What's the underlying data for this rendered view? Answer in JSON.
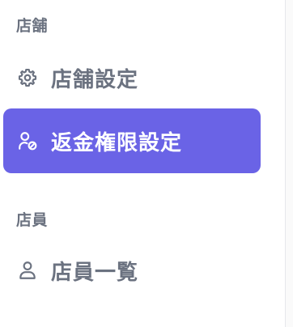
{
  "sidebar": {
    "sections": [
      {
        "title": "店舗",
        "items": [
          {
            "label": "店舗設定",
            "icon": "gear-icon",
            "active": false
          },
          {
            "label": "返金権限設定",
            "icon": "user-permission-icon",
            "active": true
          }
        ]
      },
      {
        "title": "店員",
        "items": [
          {
            "label": "店員一覧",
            "icon": "user-icon",
            "active": false
          }
        ]
      }
    ]
  },
  "colors": {
    "active_bg": "#6a63e6",
    "text_muted": "#6b7280",
    "text_active": "#ffffff"
  }
}
